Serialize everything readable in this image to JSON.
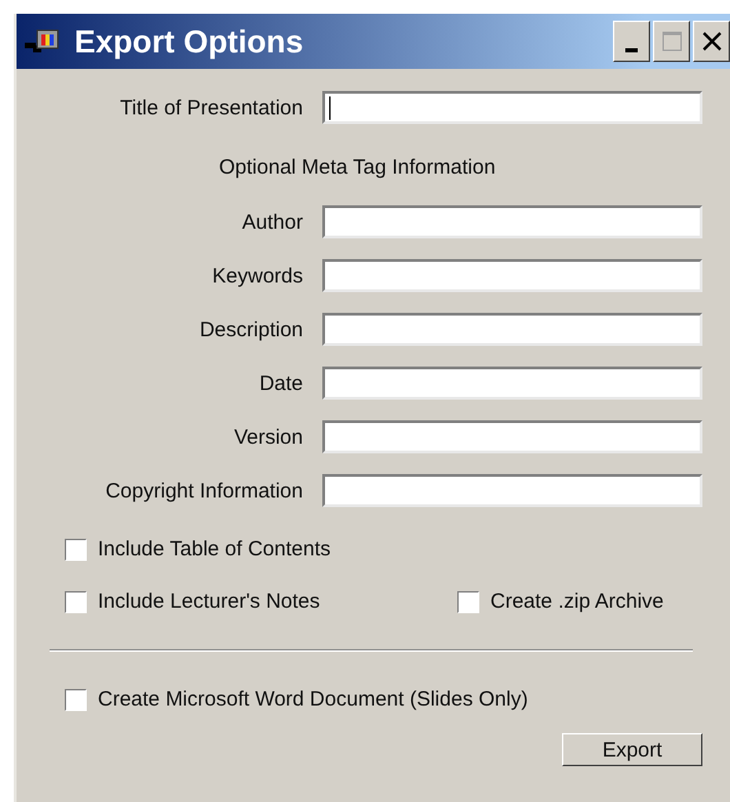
{
  "window": {
    "title": "Export Options"
  },
  "title_field": {
    "label": "Title of Presentation",
    "focused": true
  },
  "section_heading": "Optional Meta Tag Information",
  "meta_fields": [
    {
      "label": "Author"
    },
    {
      "label": "Keywords"
    },
    {
      "label": "Description"
    },
    {
      "label": "Date"
    },
    {
      "label": "Version"
    },
    {
      "label": "Copyright Information"
    }
  ],
  "options": [
    {
      "label": "Include Table of Contents",
      "checked": false
    },
    {
      "label": "Include Lecturer's Notes",
      "checked": false
    },
    {
      "label": "Create .zip Archive",
      "checked": false
    }
  ],
  "word_option": {
    "label": "Create Microsoft Word Document (Slides Only)",
    "checked": false
  },
  "buttons": [
    "Export"
  ]
}
